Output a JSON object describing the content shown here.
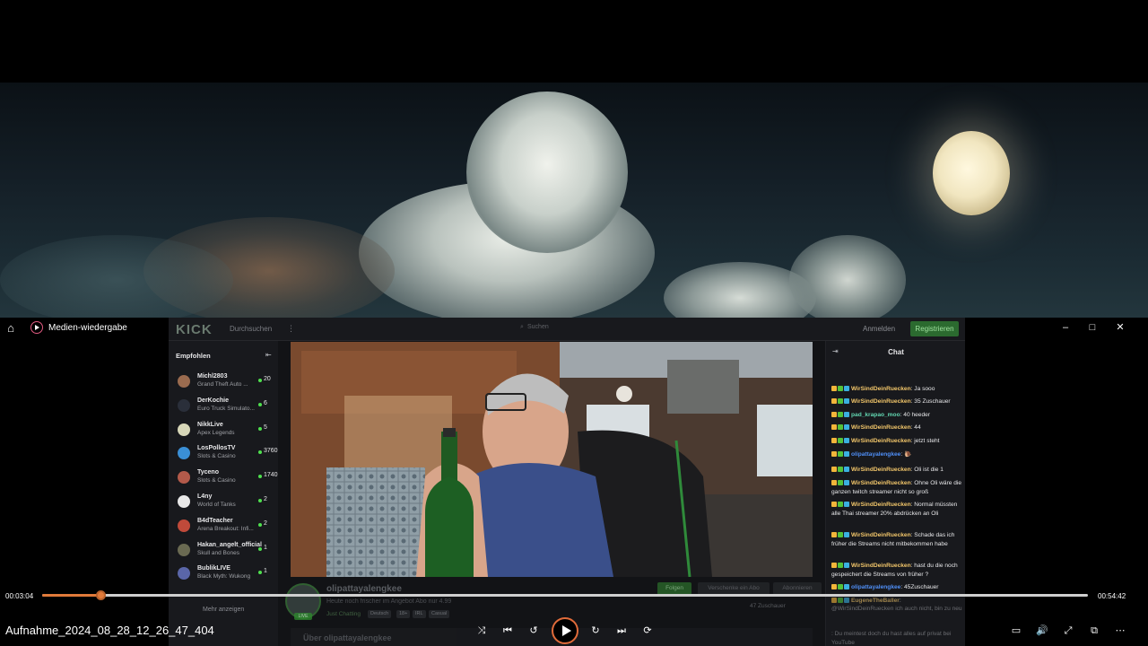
{
  "player": {
    "app_title": "Medien-wiedergabe",
    "file_name": "Aufnahme_2024_08_28_12_26_47_404",
    "time_current": "00:03:04",
    "time_total": "00:54:42",
    "progress": 0.056,
    "accent": "#e07a3a"
  },
  "window_controls": {
    "minimize": "–",
    "maximize": "□",
    "close": "✕"
  },
  "kick": {
    "logo": "KICK",
    "browse": "Durchsuchen",
    "more": "⋮",
    "search_placeholder": "Suchen",
    "login": "Anmelden",
    "register": "Registrieren",
    "brand_color": "#53fc18"
  },
  "sidebar": {
    "title": "Empfohlen",
    "collapse_icon": "collapse-icon",
    "show_more": "Mehr anzeigen",
    "channels": [
      {
        "name": "Michl2803",
        "game": "Grand Theft Auto ...",
        "viewers": "20",
        "color": "#9a6b4f"
      },
      {
        "name": "DerKochie",
        "game": "Euro Truck Simulato...",
        "viewers": "6",
        "color": "#2a2f3a"
      },
      {
        "name": "NikkLive",
        "game": "Apex Legends",
        "viewers": "5",
        "color": "#d7d7b8"
      },
      {
        "name": "LosPollosTV",
        "game": "Slots & Casino",
        "viewers": "3760",
        "color": "#3a8fd6"
      },
      {
        "name": "Tyceno",
        "game": "Slots & Casino",
        "viewers": "1740",
        "color": "#b35a4a"
      },
      {
        "name": "L4ny",
        "game": "World of Tanks",
        "viewers": "2",
        "color": "#e8e8e8"
      },
      {
        "name": "B4dTeacher",
        "game": "Arena Breakout: Infi...",
        "viewers": "2",
        "color": "#c04a3a"
      },
      {
        "name": "Hakan_angelt_official",
        "game": "Skull and Bones",
        "viewers": "1",
        "color": "#6a6a52"
      },
      {
        "name": "BublikLIVE",
        "game": "Black Myth: Wukong",
        "viewers": "1",
        "color": "#5a66a8"
      }
    ]
  },
  "stream": {
    "streamer": "olipattayalengkee",
    "title": "Heute noch frischer im Angebot Abo nur 4.99",
    "category": "Just Chatting",
    "tags": [
      "Deutsch",
      "18+",
      "IRL",
      "Casual"
    ],
    "live_badge": "LIVE",
    "follow": "Folgen",
    "gift": "Verschenke ein Abo",
    "subscribe": "Abonnieren",
    "viewers": "47 Zuschauer",
    "about": "Über olipattayalengkee"
  },
  "chat": {
    "title": "Chat",
    "messages": [
      {
        "user": "WirSindDeinRuecken",
        "text": ": Ja sooo",
        "color": "#f2c66a"
      },
      {
        "user": "WirSindDeinRuecken",
        "text": ": 35 Zuschauer",
        "color": "#f2c66a"
      },
      {
        "user": "pad_krapao_moo",
        "text": ": 40 heeder",
        "color": "#62d6b1"
      },
      {
        "user": "WirSindDeinRuecken",
        "text": ": 44",
        "color": "#f2c66a"
      },
      {
        "user": "WirSindDeinRuecken",
        "text": ": jetzt steht",
        "color": "#f2c66a"
      },
      {
        "user": "olipattayalengkee",
        "text": ": 🐌",
        "color": "#4f8ff7"
      },
      {
        "user": "WirSindDeinRuecken",
        "text": ": Oli ist die 1",
        "color": "#f2c66a"
      },
      {
        "user": "WirSindDeinRuecken",
        "text": ": Ohne Oli wäre die ganzen twitch streamer nicht so groß",
        "color": "#f2c66a"
      },
      {
        "user": "WirSindDeinRuecken",
        "text": ": Normal müssten alle Thai streamer 20% abdrücken an Oli",
        "color": "#f2c66a"
      },
      {
        "user": "WirSindDeinRuecken",
        "text": ": Schade das ich früher die Streams nicht mitbekommen habe",
        "color": "#f2c66a"
      },
      {
        "user": "WirSindDeinRuecken",
        "text": ": hast du die noch gespeichert die Streams von früher ?",
        "color": "#f2c66a"
      },
      {
        "user": "olipattayalengkee",
        "text": ": 45Zuschauer",
        "color": "#4f8ff7"
      },
      {
        "user": "EugeneTheBaller",
        "text": ":",
        "color": "#f2c66a"
      },
      {
        "user": "",
        "text": "@WirSindDeinRuecken ich auch nicht, bin zu neu",
        "color": "#9fa1a6"
      },
      {
        "user": "",
        "text": ": Du meintest doch du hast alles auf privat bei YouTube",
        "color": "#9fa1a6"
      }
    ]
  }
}
